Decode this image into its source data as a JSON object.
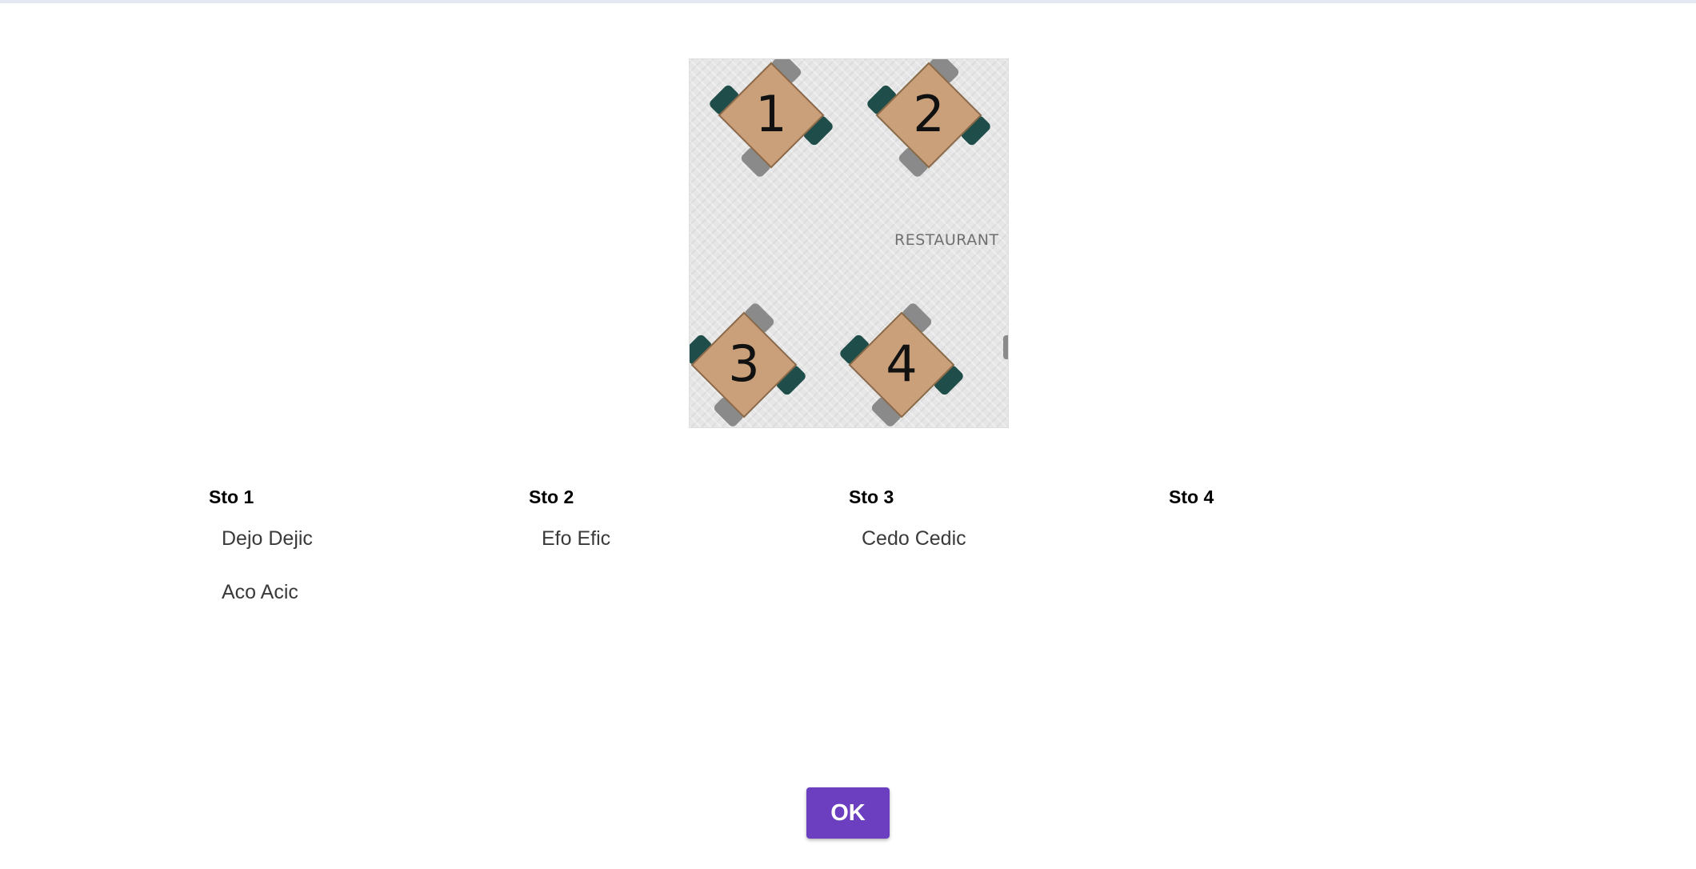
{
  "floorplan": {
    "label": "RESTAURANT",
    "tables": [
      {
        "number": "1"
      },
      {
        "number": "2"
      },
      {
        "number": "3"
      },
      {
        "number": "4"
      }
    ]
  },
  "columns": [
    {
      "title": "Sto 1",
      "guests": [
        "Dejo Dejic",
        "Aco Acic"
      ]
    },
    {
      "title": "Sto 2",
      "guests": [
        "Efo Efic"
      ]
    },
    {
      "title": "Sto 3",
      "guests": [
        "Cedo Cedic"
      ]
    },
    {
      "title": "Sto 4",
      "guests": []
    }
  ],
  "ok_label": "OK",
  "colors": {
    "accent": "#6b3fbf",
    "table_top": "#c9a07a",
    "chair_dark": "#1f4d49",
    "chair_grey": "#8a8a8a"
  }
}
